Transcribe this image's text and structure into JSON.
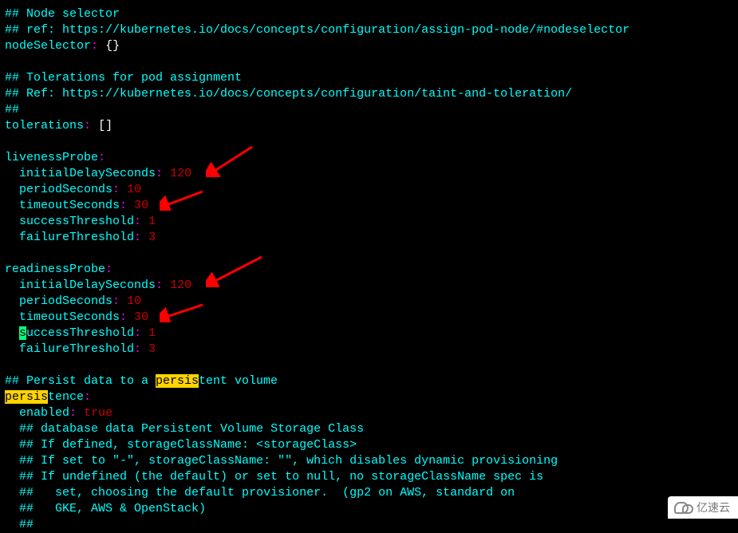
{
  "lines": {
    "c1": "## Node selector",
    "c2": "## ref: https://kubernetes.io/docs/concepts/configuration/assign-pod-node/#nodeselector",
    "k_nodeSelector": "nodeSelector",
    "v_braces": "{}",
    "c3": "## Tolerations for pod assignment",
    "c4": "## Ref: https://kubernetes.io/docs/concepts/configuration/taint-and-toleration/",
    "c5": "##",
    "k_tolerations": "tolerations",
    "v_brackets": "[]",
    "k_livenessProbe": "livenessProbe",
    "k_initialDelaySeconds": "initialDelaySeconds",
    "v_120": "120",
    "k_periodSeconds": "periodSeconds",
    "v_10": "10",
    "k_timeoutSeconds": "timeoutSeconds",
    "v_30": "30",
    "k_successThreshold": "successThreshold",
    "v_1": "1",
    "k_failureThreshold": "failureThreshold",
    "v_3": "3",
    "k_readinessProbe": "readinessProbe",
    "cursor_s": "s",
    "k_uccessThreshold": "uccessThreshold",
    "c6a": "## Persist data to a ",
    "hi_persis": "persis",
    "c6b": "tent volume",
    "k_tence": "tence",
    "k_enabled": "enabled",
    "v_true": "true",
    "c7": "## database data Persistent Volume Storage Class",
    "c8": "## If defined, storageClassName: <storageClass>",
    "c9": "## If set to \"-\", storageClassName: \"\", which disables dynamic provisioning",
    "c10": "## If undefined (the default) or set to null, no storageClassName spec is",
    "c11": "##   set, choosing the default provisioner.  (gp2 on AWS, standard on",
    "c12": "##   GKE, AWS & OpenStack)",
    "c13": "##"
  },
  "colon": ":",
  "watermark": "亿速云"
}
